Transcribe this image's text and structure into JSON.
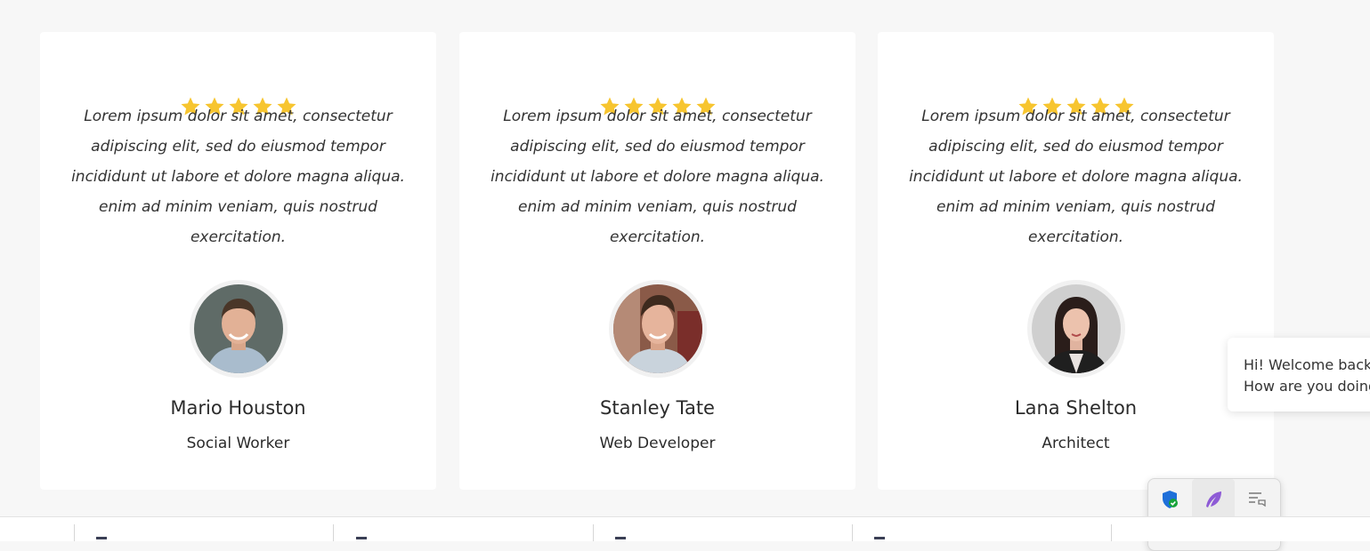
{
  "testimonials": [
    {
      "rating": 5,
      "quote": "Lorem ipsum dolor sit amet, consectetur adipiscing elit, sed do eiusmod tempor incididunt ut labore et dolore magna aliqua. enim ad minim veniam, quis nostrud exercitation.",
      "name": "Mario Houston",
      "role": "Social Worker"
    },
    {
      "rating": 5,
      "quote": "Lorem ipsum dolor sit amet, consectetur adipiscing elit, sed do eiusmod tempor incididunt ut labore et dolore magna aliqua. enim ad minim veniam, quis nostrud exercitation.",
      "name": "Stanley Tate",
      "role": "Web Developer"
    },
    {
      "rating": 5,
      "quote": "Lorem ipsum dolor sit amet, consectetur adipiscing elit, sed do eiusmod tempor incididunt ut labore et dolore magna aliqua. enim ad minim veniam, quis nostrud exercitation.",
      "name": "Lana Shelton",
      "role": "Architect"
    }
  ],
  "chat": {
    "message": "Hi! Welcome back! How are you doing?"
  },
  "tray_icons": [
    "security-shield-icon",
    "feather-pen-icon",
    "chat-icon",
    "yellow-app-icon",
    "app-icon"
  ],
  "colors": {
    "star": "#f7c52f",
    "card": "#ffffff",
    "page": "#f7f7f7"
  }
}
